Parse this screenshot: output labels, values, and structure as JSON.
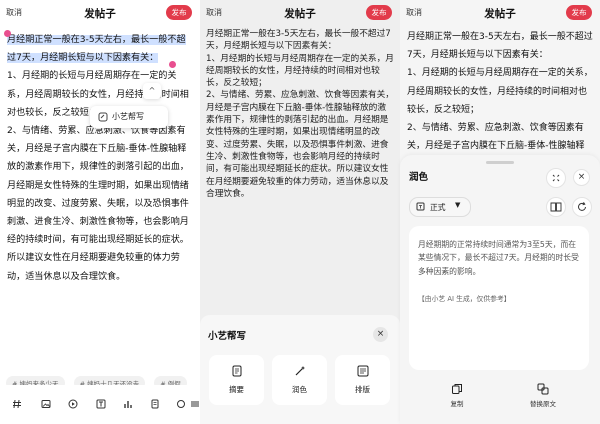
{
  "header": {
    "cancel_label": "取消",
    "title": "发帖子",
    "publish_label": "发布"
  },
  "post": {
    "highlighted_part1": "月经期正常一般在3-5天左右，最长一般不",
    "highlighted_part2": "超过7天，月经期长短与以下因素有关：",
    "rest1": "1、月经期的长短与月经周期存在一定的关系，月经周期较长的女性，月经持续的时间相对也较长，反之较短；",
    "rest2": "2、与情绪、劳累、应急刺激、饮食等因素有关，月经是子宫内膜在下丘脑-垂体-性腺轴释放的激素作用下，规律性的剥落引起的出血，月经期是女性特殊的生理时期，如果出现情绪明显的改变、过度劳累、失眠，以及恐惧事件刺激、进食生冷、刺激性食物等，也会影响月经的持续时间，有可能出现经期延长的症状。所以建议女性在月经期要避免较重的体力劳动，适当休息以及合理饮食。"
  },
  "popup": {
    "label": "小艺帮写",
    "caret": "^"
  },
  "tags": [
    "# 姨妈来多少天",
    "# 姨妈十几天还没走",
    "# 例假"
  ],
  "panel2": {
    "body": "月经期正常一般在3-5天左右，最长一般不超过7天，月经期长短与以下因素有关：\n1、月经期的长短与月经周期存在一定的关系，月经周期较长的女性，月经持续的时间相对也较长，反之较短；\n2、与情绪、劳累、应急刺激、饮食等因素有关，月经是子宫内膜在下丘脑-垂体-性腺轴释放的激素作用下，规律性的剥落引起的出血。月经期是女性特殊的生理时期，如果出现情绪明显的改变、过度劳累、失眠，以及恐惧事件刺激、进食生冷、刺激性食物等，也会影响月经的持续时间，有可能出现经期延长的症状。所以建议女性在月经期要避免较重的体力劳动，适当休息以及合理饮食。",
    "sheet_title": "小艺帮写",
    "close": "×",
    "cards": [
      "摘要",
      "润色",
      "排版"
    ]
  },
  "panel3": {
    "body": "月经期正常一般在3-5天左右，最长一般不超过7天，月经期长短与以下因素有关：\n1、月经期的长短与月经周期存在一定的关系，月经周期较长的女性，月经持续的时间相对也较长，反之较短；\n2、与情绪、劳累、应急刺激、饮食等因素有关，月经是子宫内膜在下丘脑-垂体-性腺轴释放的激素作用下，规律性的剥落引起的",
    "sheet_title": "润色",
    "style_label": "正式",
    "result_text": "月经期期的正常持续时间通常为3至5天，而在某些情况下，最长不超过7天。月经期的时长受多种因素的影响。",
    "note": "【由小艺 AI 生成，仅供参考】",
    "close": "×",
    "actions": [
      "复制",
      "替换原文"
    ]
  },
  "colors": {
    "accent": "#e23b4b",
    "selection": "#cfe0ff",
    "handle": "#e84f8f"
  }
}
